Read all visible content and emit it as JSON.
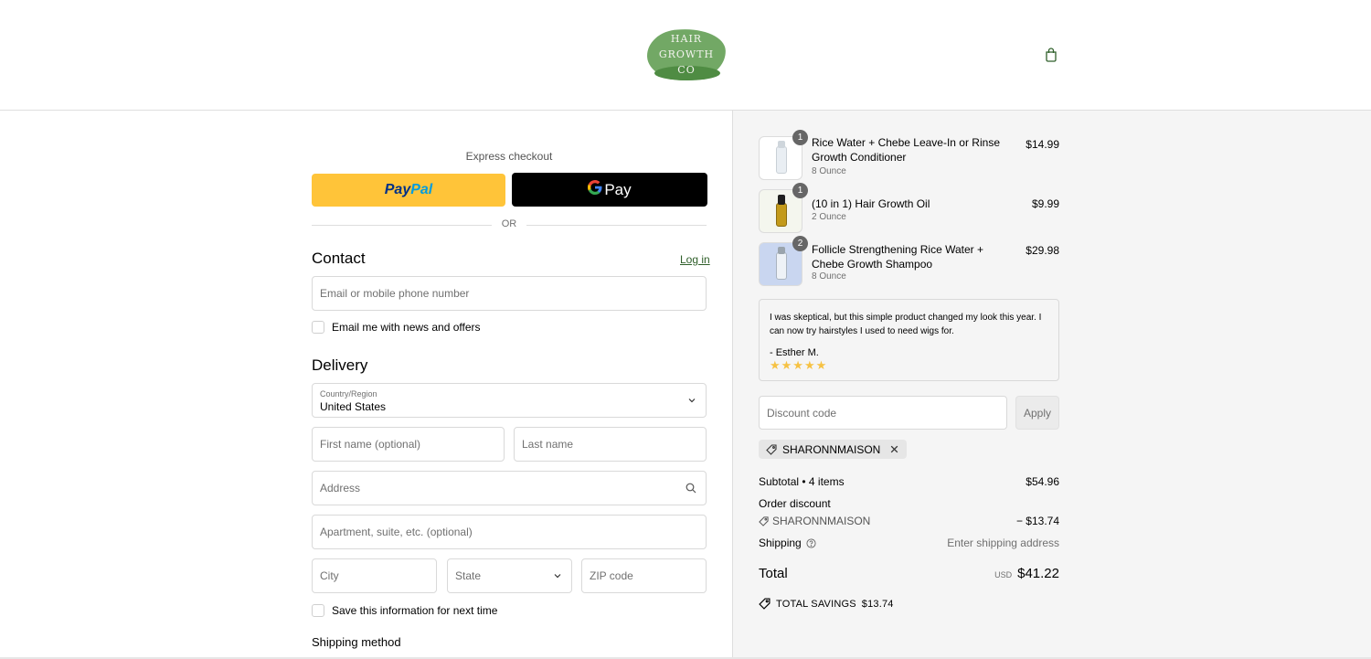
{
  "header": {
    "logo_lines": [
      "HAIR",
      "GROWTH",
      "CO"
    ],
    "cart_icon": "shopping-bag-icon"
  },
  "express": {
    "title": "Express checkout",
    "paypal_label_1": "Pay",
    "paypal_label_2": "Pal",
    "gpay_g": "G",
    "gpay_label": "Pay",
    "or": "OR"
  },
  "contact": {
    "title": "Contact",
    "login": "Log in",
    "email_placeholder": "Email or mobile phone number",
    "newsletter_label": "Email me with news and offers"
  },
  "delivery": {
    "title": "Delivery",
    "country_label": "Country/Region",
    "country_value": "United States",
    "first_name_placeholder": "First name (optional)",
    "last_name_placeholder": "Last name",
    "address_placeholder": "Address",
    "apartment_placeholder": "Apartment, suite, etc. (optional)",
    "city_placeholder": "City",
    "state_placeholder": "State",
    "zip_placeholder": "ZIP code",
    "save_label": "Save this information for next time",
    "shipping_method_title": "Shipping method"
  },
  "cart": {
    "items": [
      {
        "name": "Rice Water + Chebe Leave-In or Rinse Growth Conditioner",
        "variant": "8 Ounce",
        "price": "$14.99",
        "qty": "1",
        "bottle_color": "#e9eef3",
        "cap_color": "#cfd6dc"
      },
      {
        "name": "(10 in 1) Hair Growth Oil",
        "variant": "2 Ounce",
        "price": "$9.99",
        "qty": "1",
        "bottle_color": "#c39a1a",
        "cap_color": "#1f1f1f"
      },
      {
        "name": "Follicle Strengthening Rice Water + Chebe Growth Shampoo",
        "variant": "8 Ounce",
        "price": "$29.98",
        "qty": "2",
        "bottle_color": "#dfe6ef",
        "cap_color": "#9aa4ad"
      }
    ]
  },
  "review": {
    "quote": "I was skeptical, but this simple product changed my look this year. I can now try hairstyles I used to need wigs for.",
    "author": "- Esther M.",
    "stars": "★★★★★",
    "rating": 5
  },
  "discount": {
    "placeholder": "Discount code",
    "apply": "Apply",
    "applied_code": "SHARONNMAISON"
  },
  "totals": {
    "subtotal_label": "Subtotal • 4 items",
    "subtotal_value": "$54.96",
    "order_discount_label": "Order discount",
    "discount_code": "SHARONNMAISON",
    "discount_value": "− $13.74",
    "shipping_label": "Shipping",
    "shipping_value": "Enter shipping address",
    "total_label": "Total",
    "currency": "USD",
    "total_value": "$41.22",
    "savings_label": "TOTAL SAVINGS",
    "savings_value": "$13.74"
  },
  "colors": {
    "paypal_yellow": "#ffc439",
    "gpay_black": "#000000",
    "link_green": "#2f5f2a",
    "logo_green": "#6aa35d",
    "summary_bg": "#f5f5f5"
  }
}
